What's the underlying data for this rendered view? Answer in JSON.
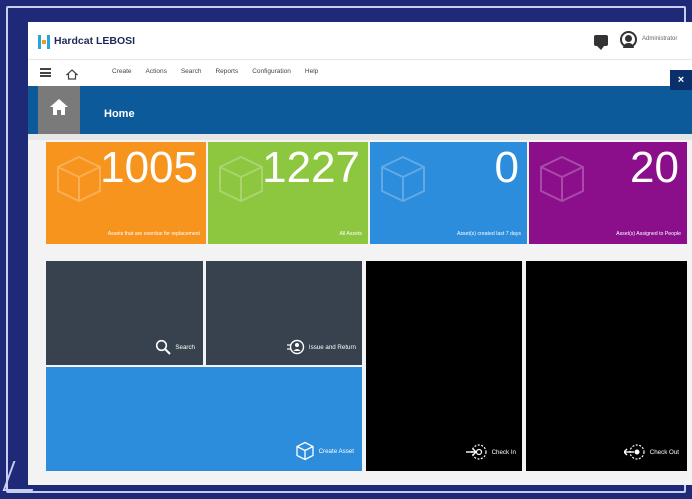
{
  "app": {
    "brand": "Hardcat LEBOSI",
    "user": "Administrator"
  },
  "nav": {
    "items": [
      "Create",
      "Actions",
      "Search",
      "Reports",
      "Configuration",
      "Help"
    ],
    "close_label": "×"
  },
  "banner": {
    "title": "Home"
  },
  "stats": [
    {
      "value": "1005",
      "caption": "Assets that are overdue for replacement",
      "color": "#f7941d"
    },
    {
      "value": "1227",
      "caption": "All Assets",
      "color": "#8dc63f"
    },
    {
      "value": "0",
      "caption": "Asset(s) created last 7 days",
      "color": "#2c8ddc"
    },
    {
      "value": "20",
      "caption": "Asset(s) Assigned to People",
      "color": "#8b0e8b"
    }
  ],
  "actions": {
    "search": "Search",
    "issue_return": "Issue and Return",
    "create_asset": "Create Asset",
    "check_in": "Check In",
    "check_out": "Check Out"
  },
  "colors": {
    "dark_tile": "#37424e",
    "black_tile": "#000000",
    "blue_tile": "#2c8ddc",
    "banner": "#0c5a99",
    "frame_bg": "#1e2a78"
  },
  "icons": {
    "logo": "hardcat-logo",
    "chat": "chat-icon",
    "user": "user-avatar-icon",
    "menu": "list-menu-icon",
    "home": "home-icon",
    "search": "search-icon",
    "issue": "issue-return-icon",
    "create": "cube-icon",
    "check_in": "check-in-icon",
    "check_out": "check-out-icon"
  }
}
